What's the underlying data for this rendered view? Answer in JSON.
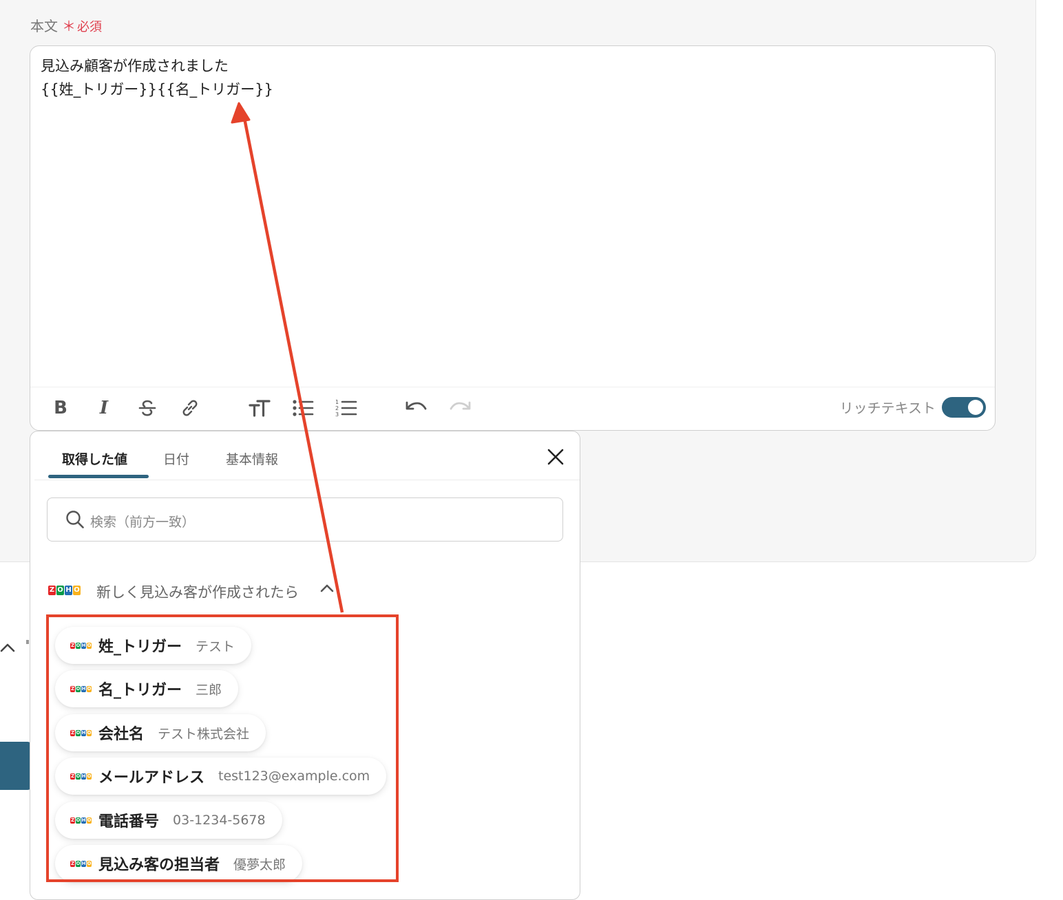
{
  "field": {
    "label": "本文",
    "required_mark": "＊",
    "required_text": "必須"
  },
  "editor": {
    "line1": "見込み顧客が作成されました",
    "line2": "{{姓_トリガー}}{{名_トリガー}}"
  },
  "toolbar": {
    "bold": "B",
    "italic": "I",
    "rich_text_label": "リッチテキスト",
    "rich_text_on": true
  },
  "popover": {
    "tabs": [
      {
        "label": "取得した値",
        "active": true
      },
      {
        "label": "日付",
        "active": false
      },
      {
        "label": "基本情報",
        "active": false
      }
    ],
    "search_placeholder": "検索（前方一致）",
    "group_title": "新しく見込み客が作成されたら",
    "logo_letters": [
      "Z",
      "O",
      "H",
      "O"
    ],
    "items": [
      {
        "name": "姓_トリガー",
        "value": "テスト"
      },
      {
        "name": "名_トリガー",
        "value": "三郎"
      },
      {
        "name": "会社名",
        "value": "テスト株式会社"
      },
      {
        "name": "メールアドレス",
        "value": "test123@example.com"
      },
      {
        "name": "電話番号",
        "value": "03-1234-5678"
      },
      {
        "name": "見込み客の担当者",
        "value": "優夢太郎"
      }
    ]
  },
  "colors": {
    "accent": "#2e6480",
    "required": "#e0404f",
    "annotation": "#e5432b",
    "zoho_red": "#e42527",
    "zoho_green": "#089949",
    "zoho_blue": "#226db4",
    "zoho_yellow": "#f9b21d"
  }
}
